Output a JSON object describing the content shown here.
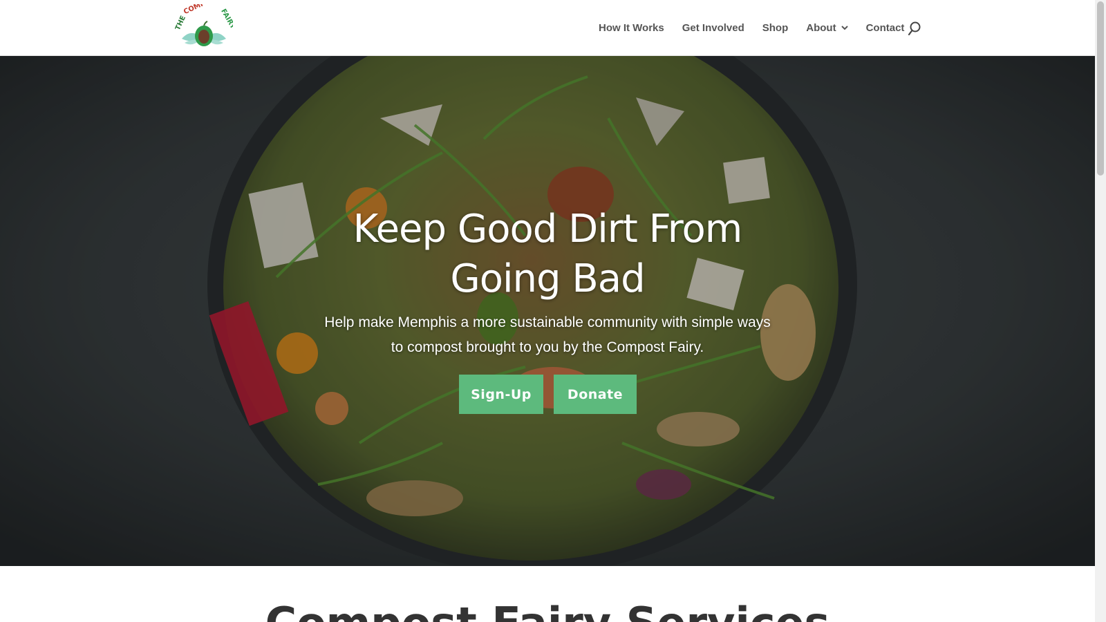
{
  "header": {
    "logo_text": "THE COMPOST FAIRY",
    "nav": [
      {
        "label": "How It Works"
      },
      {
        "label": "Get Involved"
      },
      {
        "label": "Shop"
      },
      {
        "label": "About",
        "has_dropdown": true
      },
      {
        "label": "Contact"
      }
    ],
    "search_icon": "search-icon"
  },
  "hero": {
    "title_line1": "Keep Good Dirt From",
    "title_line2": "Going Bad",
    "subtitle_line1": "Help make Memphis a more sustainable community with simple ways",
    "subtitle_line2": "to compost brought to you by the Compost Fairy.",
    "signup_label": "Sign-Up",
    "donate_label": "Donate"
  },
  "services": {
    "title": "Compost Fairy Services"
  },
  "colors": {
    "accent": "#5dba7d",
    "nav_text": "#555555",
    "logo_green": "#2e9a4a",
    "logo_teal": "#8fd3c6"
  }
}
